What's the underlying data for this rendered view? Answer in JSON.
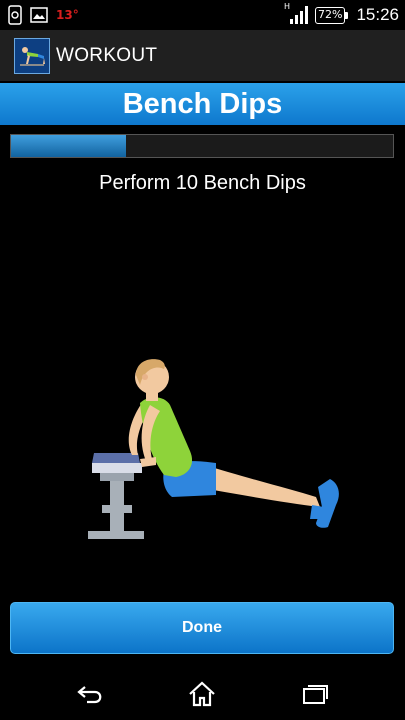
{
  "status_bar": {
    "temperature": "13°",
    "signal_letter": "H",
    "battery": "72%",
    "time": "15:26"
  },
  "action_bar": {
    "title": "WORKOUT"
  },
  "exercise": {
    "name": "Bench Dips",
    "instruction": "Perform 10 Bench Dips",
    "progress_percent": 30
  },
  "done_button": {
    "label": "Done"
  },
  "colors": {
    "accent": "#1a8ad8",
    "shirt": "#8ed33a",
    "shorts": "#2f86de"
  }
}
